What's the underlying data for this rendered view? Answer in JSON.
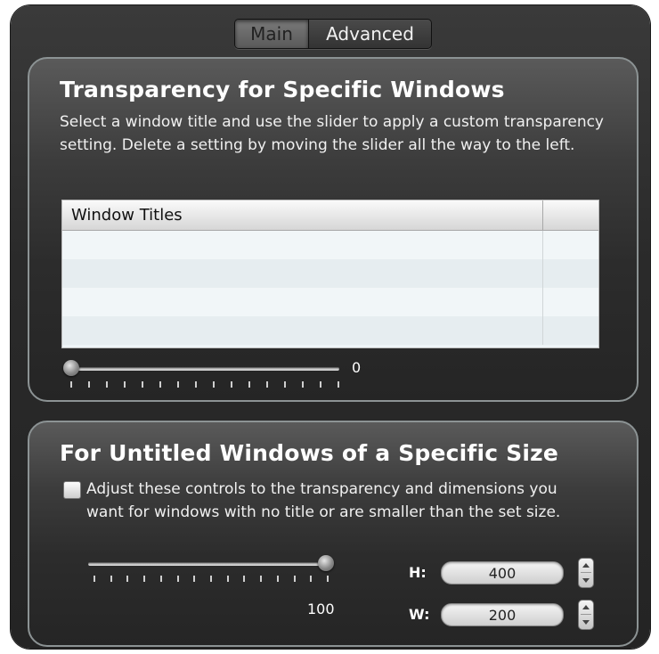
{
  "tabs": {
    "main": "Main",
    "advanced": "Advanced"
  },
  "specific_windows": {
    "title": "Transparency for Specific Windows",
    "description": "Select a window title and use the slider to apply a custom transparency setting. Delete a setting by moving the slider all the way to the left.",
    "table": {
      "column_header": "Window Titles",
      "rows": [
        "",
        "",
        "",
        ""
      ]
    },
    "slider_value": "0",
    "slider_level": 0
  },
  "untitled_windows": {
    "title": "For Untitled Windows of a Specific Size",
    "checkbox_label_line1": "Adjust these controls to the transparency and dimensions you",
    "checkbox_label_line2": "want for windows with no title or are smaller than the set size.",
    "checkbox_checked": false,
    "slider_value": "100",
    "slider_level": 100,
    "height_label": "H:",
    "height_value": "400",
    "width_label": "W:",
    "width_value": "200"
  }
}
